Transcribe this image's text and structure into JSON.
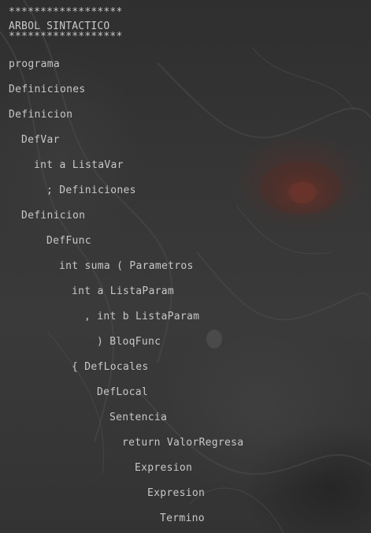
{
  "console": {
    "header_top": "******************",
    "header_title": "ARBOL SINTACTICO",
    "header_bottom": "******************",
    "tree": [
      "programa",
      "Definiciones",
      "Definicion",
      "DefVar",
      "int a ListaVar",
      "; Definiciones",
      "Definicion",
      "DefFunc",
      "int suma ( Parametros",
      "int a ListaParam",
      ", int b ListaParam",
      ") BloqFunc",
      "{ DefLocales",
      "DefLocal",
      "Sentencia",
      "return ValorRegresa",
      "Expresion",
      "Expresion",
      "Termino"
    ]
  }
}
